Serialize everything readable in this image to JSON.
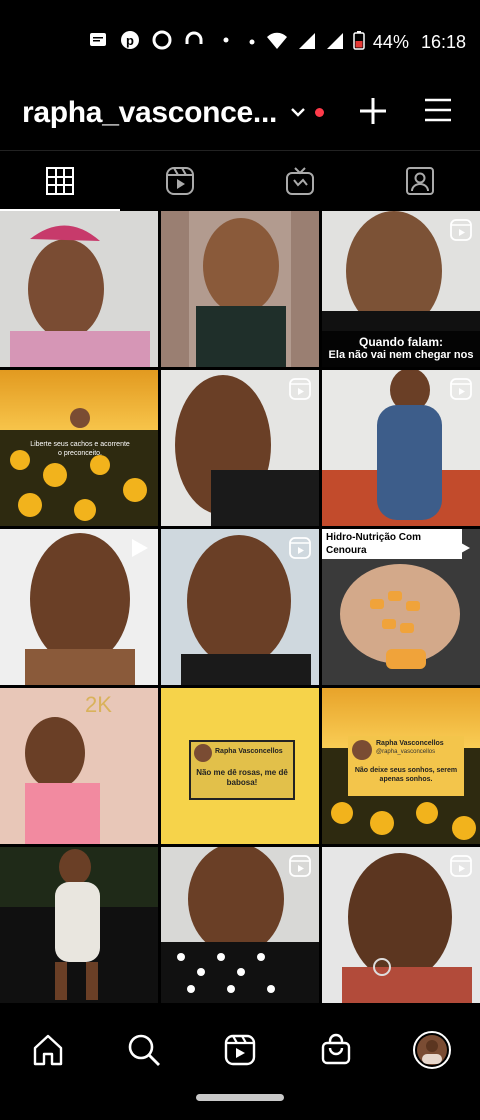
{
  "status_bar": {
    "battery": "44%",
    "time": "16:18"
  },
  "header": {
    "username": "rapha_vasconce..."
  },
  "tabs": [
    {
      "label": "Posts grid",
      "icon": "grid-icon"
    },
    {
      "label": "Reels",
      "icon": "reels-icon"
    },
    {
      "label": "IGTV",
      "icon": "tv-icon"
    },
    {
      "label": "Tagged",
      "icon": "tagged-icon"
    }
  ],
  "grid": {
    "captions": {
      "quando_falam_title": "Quando falam:",
      "quando_falam_sub": "Ela não vai nem chegar nos",
      "liberte": "Liberte seus cachos e acorrente o preconceito.",
      "hidro": "Hidro-Nutrição Com Cenoura",
      "rapha_name": "Rapha Vasconcellos",
      "nao_rosas": "Não me dê rosas, me dê babosa!",
      "rapha_name_2": "Rapha Vasconcellos",
      "handle": "@rapha_vasconcellos",
      "sonhos": "Não deixe seus sonhos, serem apenas sonhos."
    }
  },
  "bottom_nav": [
    {
      "name": "home",
      "icon": "home-icon"
    },
    {
      "name": "search",
      "icon": "search-icon"
    },
    {
      "name": "reels",
      "icon": "reels-icon"
    },
    {
      "name": "shop",
      "icon": "shop-icon"
    },
    {
      "name": "profile",
      "icon": "profile-avatar"
    }
  ],
  "colors": {
    "background": "#000000",
    "notification_dot": "#ff3b4a",
    "yellow_tile": "#f6d34a"
  }
}
